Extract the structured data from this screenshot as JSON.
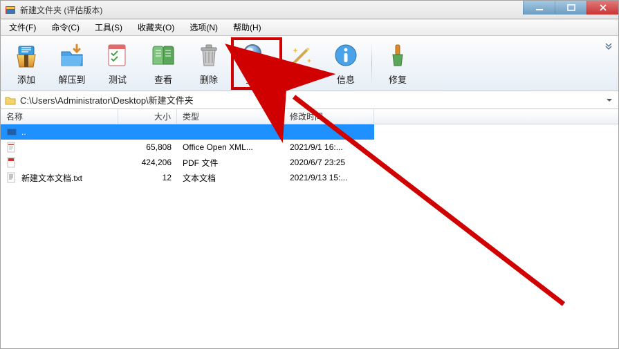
{
  "window": {
    "title": "新建文件夹 (评估版本)"
  },
  "menu": {
    "file": "文件(F)",
    "command": "命令(C)",
    "tools": "工具(S)",
    "favorites": "收藏夹(O)",
    "options": "选项(N)",
    "help": "帮助(H)"
  },
  "toolbar": {
    "add": "添加",
    "extract_to": "解压到",
    "test": "测试",
    "view": "查看",
    "delete": "删除",
    "find": "查找",
    "wizard": "向导",
    "info": "信息",
    "repair": "修复"
  },
  "address": {
    "path": "C:\\Users\\Administrator\\Desktop\\新建文件夹"
  },
  "columns": {
    "name": "名称",
    "size": "大小",
    "type": "类型",
    "modified": "修改时间"
  },
  "rows": {
    "up": {
      "name": ".."
    },
    "r1": {
      "name": "",
      "size": "65,808",
      "type": "Office Open XML...",
      "date": "2021/9/1 16:..."
    },
    "r2": {
      "name": "",
      "size": "424,206",
      "type": "PDF 文件",
      "date": "2020/6/7 23:25"
    },
    "r3": {
      "name": "新建文本文档.txt",
      "size": "12",
      "type": "文本文档",
      "date": "2021/9/13 15:..."
    }
  }
}
